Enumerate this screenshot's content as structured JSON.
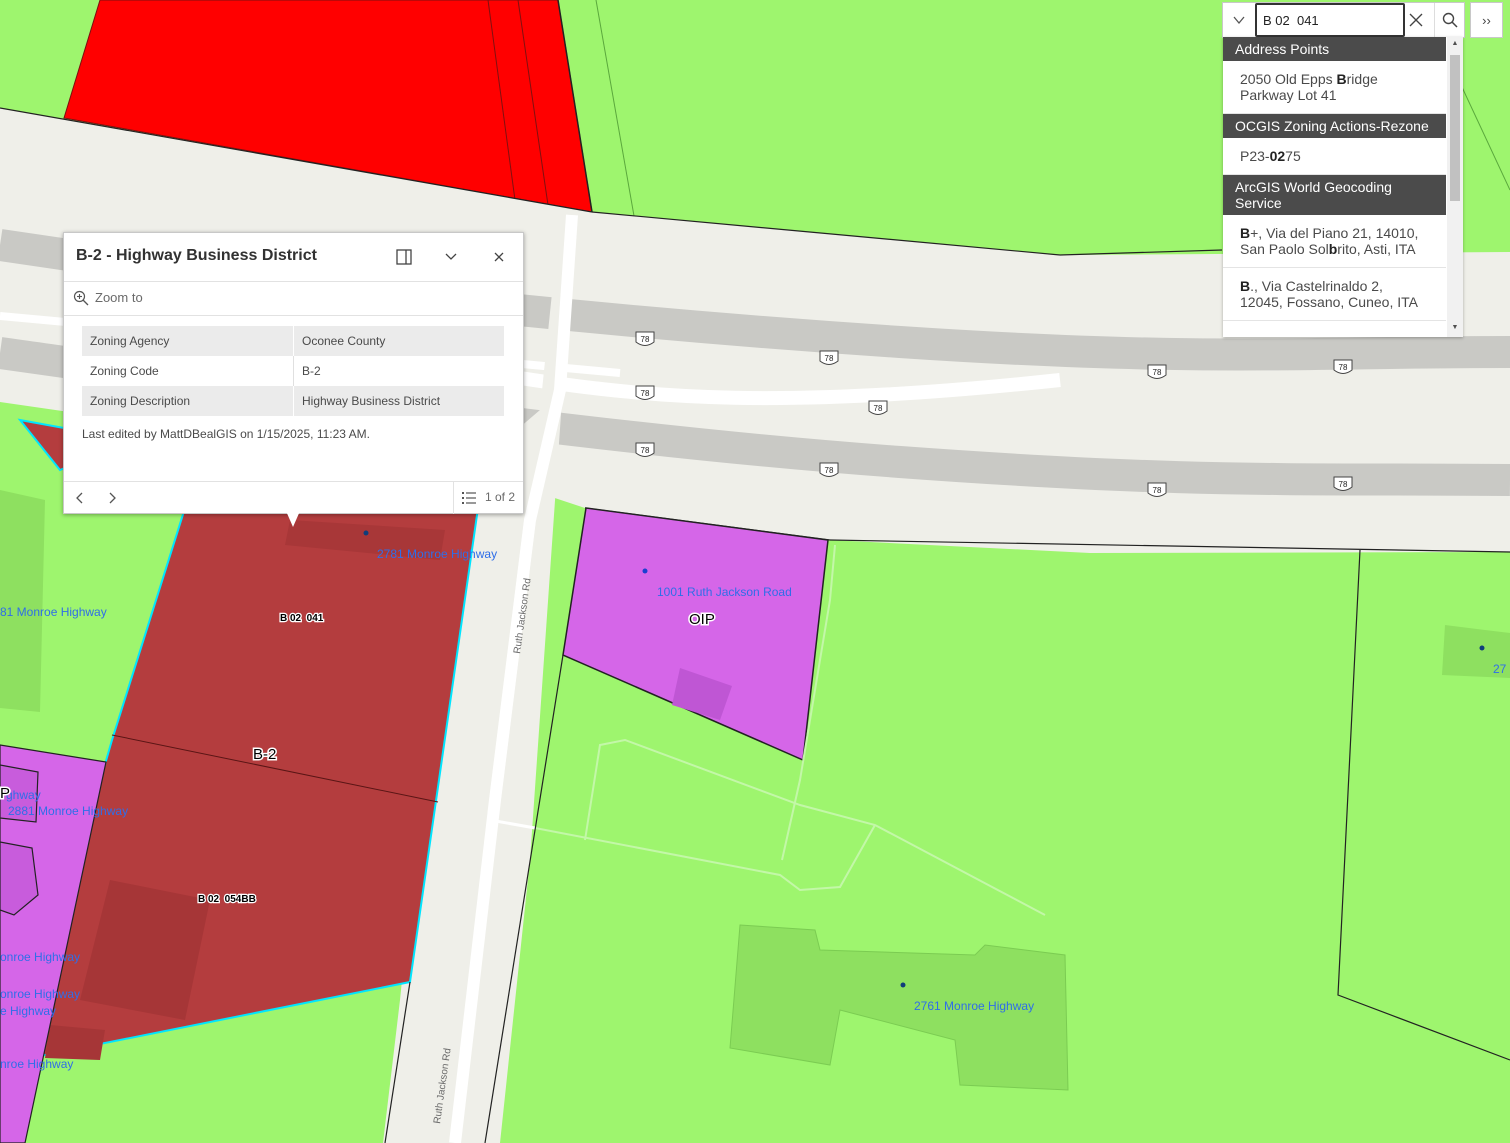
{
  "colors": {
    "background_zone": "#9ef56e",
    "commercial_red": "#ff0000",
    "b2_zone": "#b43d3e",
    "oip_zone": "#d566e8",
    "road": "#e8e8e2",
    "highway": "#cfcfcf",
    "label_blue": "#2f6ee8",
    "selection_outline": "#00e5ff"
  },
  "map": {
    "zone_labels": [
      "OIP",
      "B-2",
      "P"
    ],
    "parcel_labels": [
      "B 02  041",
      "B 02  054BB"
    ],
    "road_labels": [
      "Ruth Jackson Rd",
      "Ruth Jackson Rd"
    ],
    "highway_shield": "78",
    "address_labels": [
      "2781 Monroe Highway",
      "81 Monroe Highway",
      "1001 Ruth Jackson Road",
      "ghway",
      "2881 Monroe Highway",
      "onroe Highway",
      "onroe Highway",
      "e Highway",
      "nroe Highway",
      "2761 Monroe Highway",
      "27"
    ]
  },
  "popup": {
    "title": "B-2 - Highway Business District",
    "zoom_label": "Zoom to",
    "attributes": [
      {
        "key": "Zoning Agency",
        "value": "Oconee County"
      },
      {
        "key": "Zoning Code",
        "value": "B-2"
      },
      {
        "key": "Zoning Description",
        "value": "Highway Business District"
      }
    ],
    "edited": "Last edited by MattDBealGIS on 1/15/2025, 11:23 AM.",
    "count": "1 of 2",
    "icons": [
      "dock-icon",
      "collapse-icon",
      "close-icon",
      "zoom-to-icon",
      "previous-icon",
      "next-icon",
      "feature-list-icon"
    ]
  },
  "search": {
    "value": "B 02  041",
    "expand_label": "››",
    "groups": [
      {
        "name": "Address Points",
        "items": [
          {
            "parts": [
              {
                "t": "2050 Old Epps ",
                "b": false
              },
              {
                "t": "B",
                "b": true
              },
              {
                "t": "ridge Parkway Lot 41",
                "b": false
              }
            ]
          }
        ]
      },
      {
        "name": "OCGIS Zoning Actions-Rezone",
        "items": [
          {
            "parts": [
              {
                "t": "P23-",
                "b": false
              },
              {
                "t": "02",
                "b": true
              },
              {
                "t": "75",
                "b": false
              }
            ]
          }
        ]
      },
      {
        "name": "ArcGIS World Geocoding Service",
        "items": [
          {
            "parts": [
              {
                "t": "B",
                "b": true
              },
              {
                "t": "+, Via del Piano 21, 14010, San Paolo Sol",
                "b": false
              },
              {
                "t": "b",
                "b": true
              },
              {
                "t": "rito, Asti, ITA",
                "b": false
              }
            ]
          },
          {
            "parts": [
              {
                "t": "B",
                "b": true
              },
              {
                "t": "., Via Castelrinaldo 2, 12045, Fossano, Cuneo, ITA",
                "b": false
              }
            ]
          }
        ]
      }
    ]
  }
}
